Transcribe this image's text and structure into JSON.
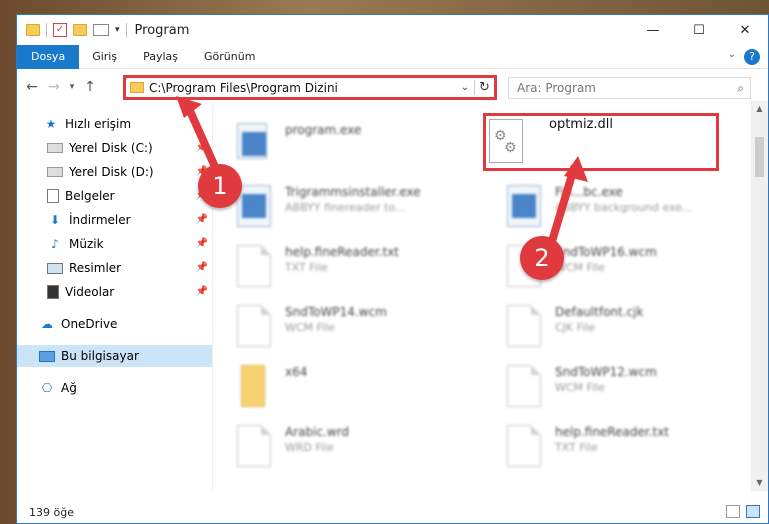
{
  "window": {
    "title": "Program"
  },
  "ribbon": {
    "tabs": [
      "Dosya",
      "Giriş",
      "Paylaş",
      "Görünüm"
    ]
  },
  "address": {
    "path": "C:\\Program Files\\Program Dizini"
  },
  "search": {
    "placeholder": "Ara: Program"
  },
  "sidebar": {
    "quick_access": "Hızlı erişim",
    "items": [
      "Yerel Disk (C:)",
      "Yerel Disk (D:)",
      "Belgeler",
      "İndirmeler",
      "Müzik",
      "Resimler",
      "Videolar"
    ],
    "onedrive": "OneDrive",
    "this_pc": "Bu bilgisayar",
    "network": "Ağ"
  },
  "files": [
    {
      "name": "program.exe",
      "sub": ""
    },
    {
      "name": "Trigrammsinstaller.exe",
      "sub": "ABBYY finereader to..."
    },
    {
      "name": "Fin...bc.exe",
      "sub": "ABBYY background exe..."
    },
    {
      "name": "help.fineReader.txt",
      "sub": "TXT File"
    },
    {
      "name": "SndToWP16.wcm",
      "sub": "WCM File"
    },
    {
      "name": "SndToWP14.wcm",
      "sub": "WCM File"
    },
    {
      "name": "Defaultfont.cjk",
      "sub": "CJK File"
    },
    {
      "name": "x64",
      "sub": ""
    },
    {
      "name": "SndToWP12.wcm",
      "sub": "WCM File"
    },
    {
      "name": "Arabic.wrd",
      "sub": "WRD File"
    },
    {
      "name": "help.fineReader.txt",
      "sub": "TXT File"
    }
  ],
  "highlight_file": {
    "name": "optmiz.dll"
  },
  "status": {
    "count": "139 öğe"
  },
  "annotations": {
    "step1": "1",
    "step2": "2"
  },
  "colors": {
    "accent": "#1979ca",
    "annotation": "#e0393e",
    "selection": "#cce4f7"
  }
}
